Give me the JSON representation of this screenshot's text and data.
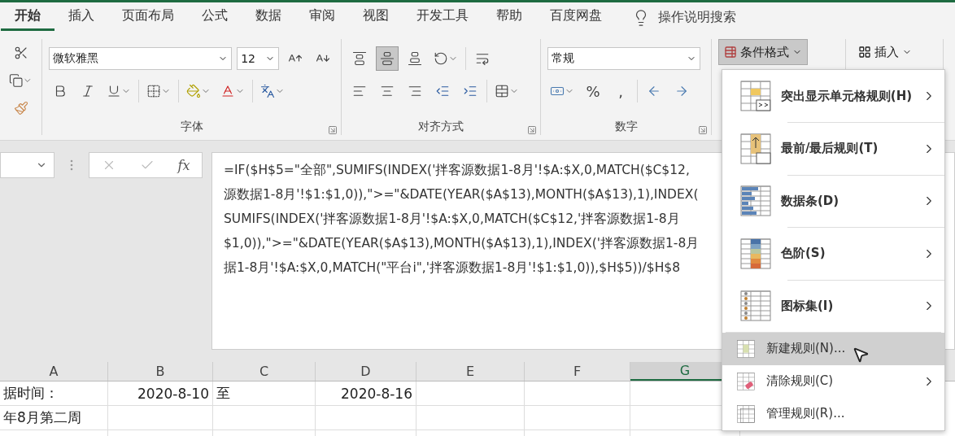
{
  "tabs": [
    {
      "label": "开始",
      "selected": true
    },
    {
      "label": "插入",
      "selected": false
    },
    {
      "label": "页面布局",
      "selected": false
    },
    {
      "label": "公式",
      "selected": false
    },
    {
      "label": "数据",
      "selected": false
    },
    {
      "label": "审阅",
      "selected": false
    },
    {
      "label": "视图",
      "selected": false
    },
    {
      "label": "开发工具",
      "selected": false
    },
    {
      "label": "帮助",
      "selected": false
    },
    {
      "label": "百度网盘",
      "selected": false
    }
  ],
  "tell_me": {
    "placeholder": "操作说明搜索"
  },
  "ribbon": {
    "font": {
      "label": "字体",
      "font_name": "微软雅黑",
      "font_size": "12"
    },
    "alignment": {
      "label": "对齐方式",
      "vertical_align": [
        {
          "selected": false
        },
        {
          "selected": true
        },
        {
          "selected": false
        }
      ]
    },
    "number": {
      "label": "数字",
      "format": "常规",
      "symbols": [
        "%",
        ","
      ]
    },
    "styles": {
      "conditional_format": {
        "label": "条件格式",
        "expanded": true
      }
    },
    "cells": {
      "insert": {
        "label": "插入"
      }
    }
  },
  "formula_bar": {
    "fx": "fx",
    "lines": [
      "=IF($H$5=\"全部\",SUMIFS(INDEX('拌客源数据1-8月'!$A:$X,0,MATCH($C$12,",
      "源数据1-8月'!$1:$1,0)),\">=\"&DATE(YEAR($A$13),MONTH($A$13),1),INDEX(",
      "SUMIFS(INDEX('拌客源数据1-8月'!$A:$X,0,MATCH($C$12,'拌客源数据1-8月",
      "$1,0)),\">=\"&DATE(YEAR($A$13),MONTH($A$13),1),INDEX('拌客源数据1-8月",
      "据1-8月'!$A:$X,0,MATCH(\"平台i\",'拌客源数据1-8月'!$1:$1,0)),$H$5))/$H$8"
    ]
  },
  "sheet": {
    "columns": [
      {
        "label": "A",
        "selected": false
      },
      {
        "label": "B",
        "selected": false
      },
      {
        "label": "C",
        "selected": false
      },
      {
        "label": "D",
        "selected": false
      },
      {
        "label": "E",
        "selected": false
      },
      {
        "label": "F",
        "selected": false
      },
      {
        "label": "G",
        "selected": true
      }
    ],
    "rows": [
      [
        {
          "text": "据时间：",
          "kind": "text"
        },
        {
          "text": "2020-8-10",
          "kind": "number"
        },
        {
          "text": "至",
          "kind": "text"
        },
        {
          "text": "2020-8-16",
          "kind": "number"
        },
        null,
        null,
        null
      ],
      [
        {
          "text": "年8月第二周",
          "kind": "text"
        },
        null,
        null,
        null,
        null,
        null,
        null
      ],
      [
        null,
        null,
        null,
        null,
        null,
        null,
        null
      ]
    ]
  },
  "menu": {
    "items": [
      {
        "kind": "large",
        "label": "突出显示单元格规则(H)",
        "submenu": true,
        "selected": false
      },
      {
        "kind": "large",
        "label": "最前/最后规则(T)",
        "submenu": true,
        "selected": false
      },
      {
        "kind": "large",
        "label": "数据条(D)",
        "submenu": true,
        "selected": false
      },
      {
        "kind": "large",
        "label": "色阶(S)",
        "submenu": true,
        "selected": false
      },
      {
        "kind": "large",
        "label": "图标集(I)",
        "submenu": true,
        "selected": false
      },
      {
        "kind": "small",
        "label": "新建规则(N)...",
        "submenu": false,
        "selected": true
      },
      {
        "kind": "small",
        "label": "清除规则(C)",
        "submenu": true,
        "selected": false
      },
      {
        "kind": "small",
        "label": "管理规则(R)...",
        "submenu": false,
        "selected": false
      }
    ]
  }
}
